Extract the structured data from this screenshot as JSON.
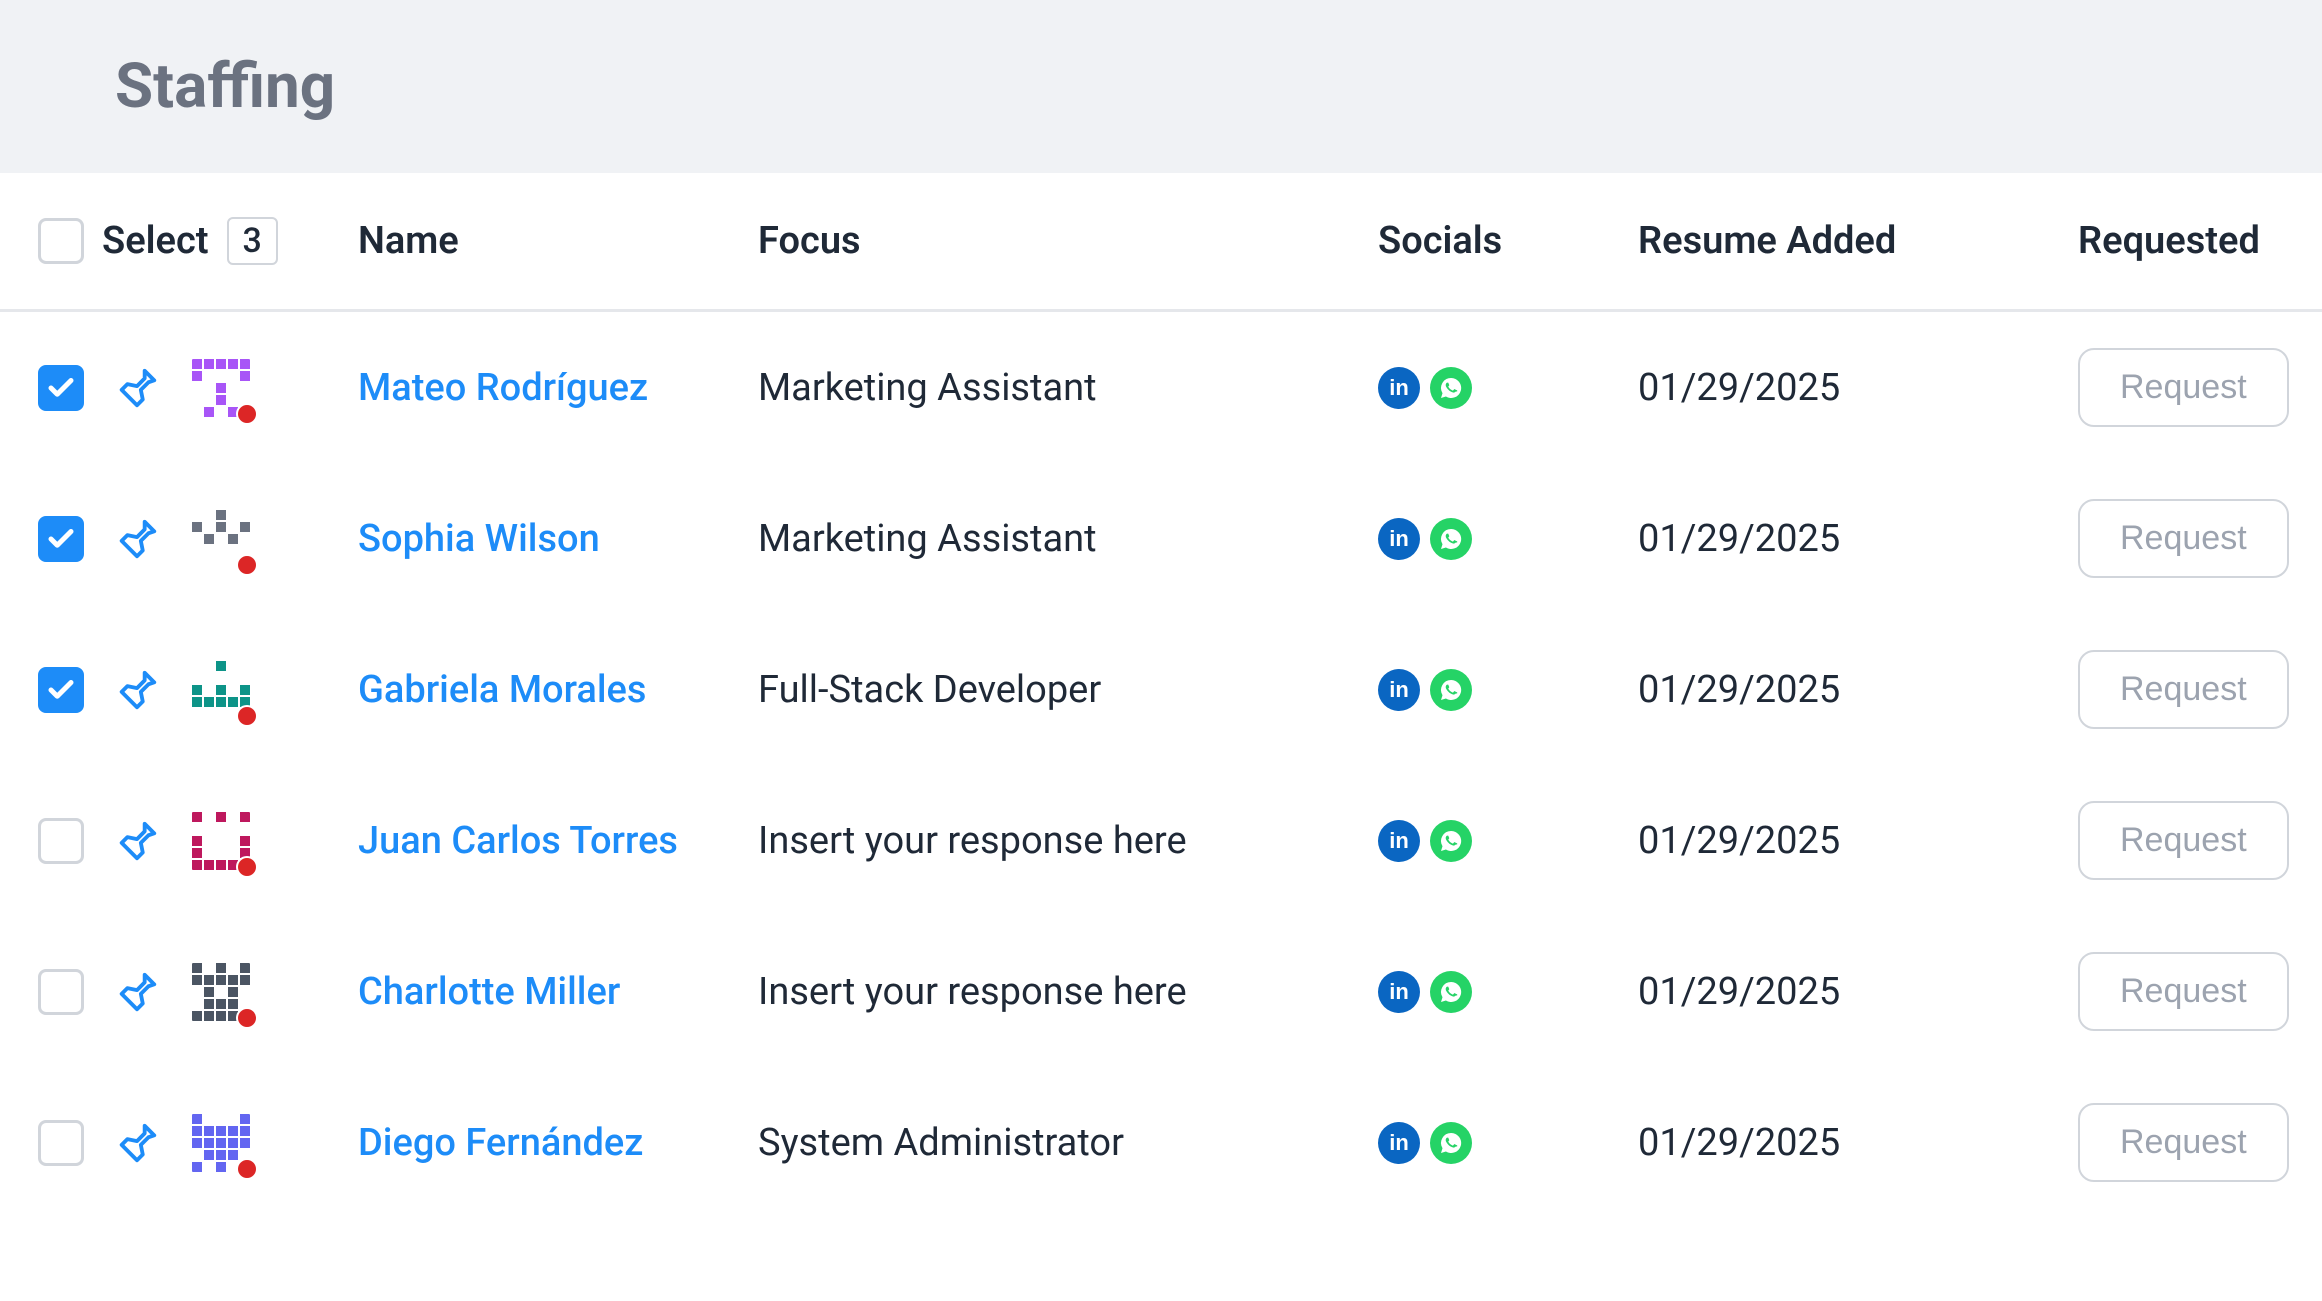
{
  "page": {
    "title": "Staffing"
  },
  "header": {
    "select_label": "Select",
    "select_count": "3",
    "columns": {
      "name": "Name",
      "focus": "Focus",
      "socials": "Socials",
      "resume": "Resume Added",
      "requested": "Requested"
    }
  },
  "request_button_label": "Request",
  "rows": [
    {
      "checked": true,
      "name": "Mateo Rodríguez",
      "focus": "Marketing Assistant",
      "resume": "01/29/2025",
      "avatar_color": "#a855f7"
    },
    {
      "checked": true,
      "name": "Sophia Wilson",
      "focus": "Marketing Assistant",
      "resume": "01/29/2025",
      "avatar_color": "#6b7280"
    },
    {
      "checked": true,
      "name": "Gabriela Morales",
      "focus": "Full-Stack Developer",
      "resume": "01/29/2025",
      "avatar_color": "#0d9488"
    },
    {
      "checked": false,
      "name": "Juan Carlos Torres",
      "focus": "Insert your response here",
      "resume": "01/29/2025",
      "avatar_color": "#be185d"
    },
    {
      "checked": false,
      "name": "Charlotte Miller",
      "focus": "Insert your response here",
      "resume": "01/29/2025",
      "avatar_color": "#4b5563"
    },
    {
      "checked": false,
      "name": "Diego Fernández",
      "focus": "System Administrator",
      "resume": "01/29/2025",
      "avatar_color": "#6366f1"
    }
  ]
}
